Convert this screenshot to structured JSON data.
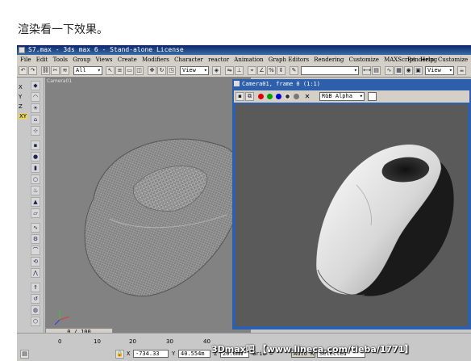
{
  "caption": "渲染看一下效果。",
  "window": {
    "title": "S7.max - 3ds max 6 - Stand-alone License"
  },
  "menubar": {
    "items": [
      "File",
      "Edit",
      "Tools",
      "Group",
      "Views",
      "Create",
      "Modifiers",
      "Character",
      "reactor",
      "Animation",
      "Graph Editors",
      "Rendering",
      "Customize",
      "MAXScript",
      "Help"
    ],
    "right_items": [
      "Rendering",
      "Customize"
    ]
  },
  "toolbar": {
    "selection_filter": "All",
    "view_dropdown": "View",
    "view_dropdown_right": "View"
  },
  "left_axes": [
    "X",
    "Y",
    "Z",
    "XY"
  ],
  "viewport_left": {
    "label": "Camera01"
  },
  "camera_window": {
    "title": "Camera01, frame 0 (1:1)",
    "channel": "RGB Alpha"
  },
  "timeline": {
    "frame": "0 / 100",
    "ticks": [
      "0",
      "10",
      "20",
      "30",
      "40"
    ]
  },
  "status": {
    "x_label": "X",
    "x_value": "-734.33",
    "y_label": "Y",
    "y_value": "40.554m",
    "z_label": "Z",
    "z_value": "20.0mm",
    "grid_label": "Grid =",
    "autokey": "Auto Key",
    "selected": "Selected"
  },
  "watermark": "3Dmax吧 【www.lineca.com/tieba/1771】"
}
